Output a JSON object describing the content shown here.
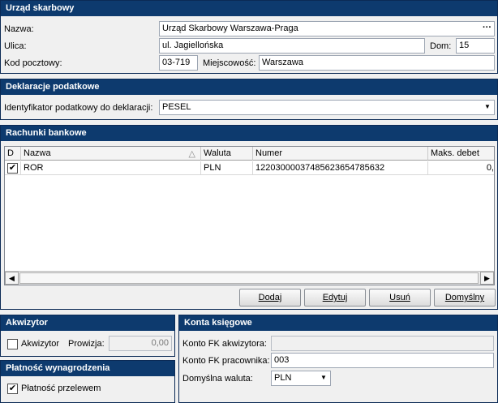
{
  "urzad": {
    "title": "Urząd skarbowy",
    "nazwa_label": "Nazwa:",
    "nazwa_value": "Urząd Skarbowy Warszawa-Praga",
    "ellipsis": "···",
    "ulica_label": "Ulica:",
    "ulica_value": "ul. Jagiellońska",
    "dom_label": "Dom:",
    "dom_value": "15",
    "kod_label": "Kod pocztowy:",
    "kod_value": "03-719",
    "miejscowosc_label": "Miejscowość:",
    "miejscowosc_value": "Warszawa"
  },
  "deklaracje": {
    "title": "Deklaracje podatkowe",
    "identyfikator_label": "Identyfikator podatkowy do deklaracji:",
    "identyfikator_value": "PESEL"
  },
  "rachunki": {
    "title": "Rachunki bankowe",
    "columns": {
      "d": "D",
      "nazwa": "Nazwa",
      "waluta": "Waluta",
      "numer": "Numer",
      "maks": "Maks. debet"
    },
    "rows": [
      {
        "checked": true,
        "nazwa": "ROR",
        "waluta": "PLN",
        "numer": "12203000037485623654785632",
        "maks": "0,"
      }
    ],
    "buttons": {
      "dodaj": "Dodaj",
      "edytuj": "Edytuj",
      "usun": "Usuń",
      "domyslny": "Domyślny"
    }
  },
  "akwizytor": {
    "title": "Akwizytor",
    "checkbox_label": "Akwizytor",
    "checked": false,
    "prowizja_label": "Prowizja:",
    "prowizja_value": "0,00"
  },
  "platnosc": {
    "title": "Płatność wynagrodzenia",
    "checkbox_label": "Płatność przelewem",
    "checked": true
  },
  "konta": {
    "title": "Konta księgowe",
    "akwizytora_label": "Konto FK akwizytora:",
    "akwizytora_value": "",
    "pracownika_label": "Konto FK pracownika:",
    "pracownika_value": "003",
    "waluta_label": "Domyślna waluta:",
    "waluta_value": "PLN"
  }
}
